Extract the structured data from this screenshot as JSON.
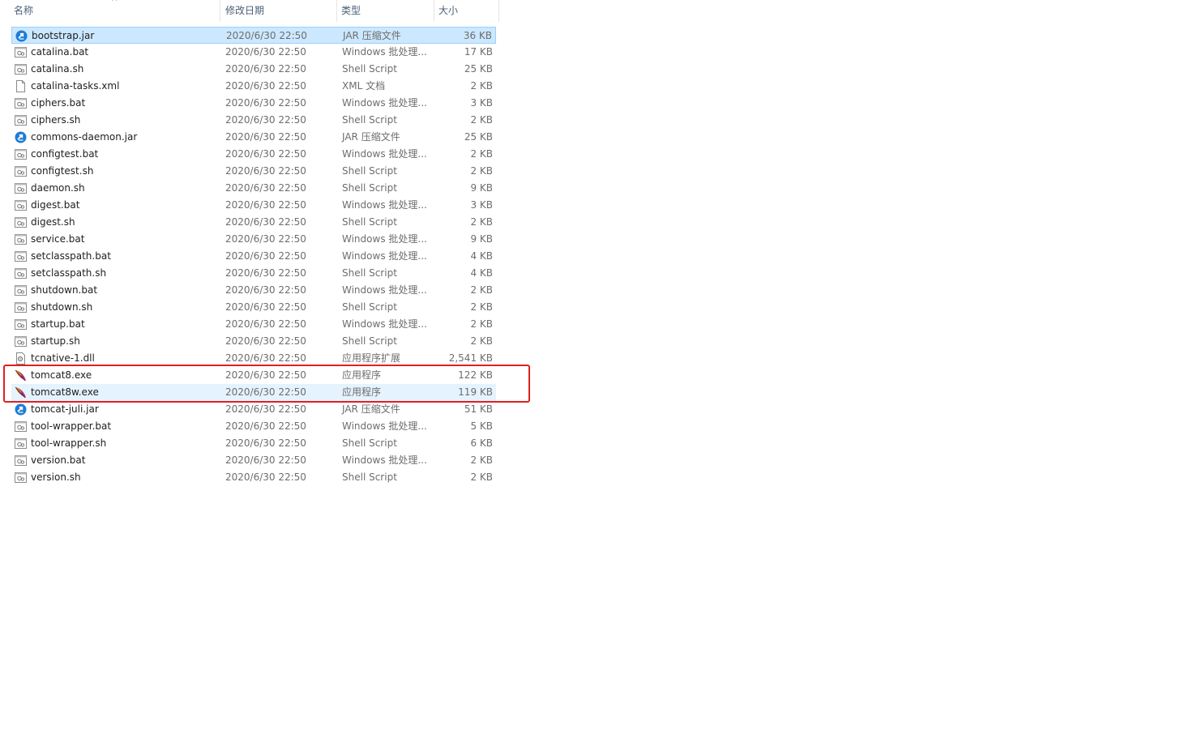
{
  "columns": {
    "name": "名称",
    "date": "修改日期",
    "type": "类型",
    "size": "大小"
  },
  "sort_indicator": "^",
  "files": [
    {
      "name": "bootstrap.jar",
      "date": "2020/6/30 22:50",
      "type": "JAR 压缩文件",
      "size": "36 KB",
      "icon": "jar-icon",
      "state": "selected"
    },
    {
      "name": "catalina.bat",
      "date": "2020/6/30 22:50",
      "type": "Windows 批处理...",
      "size": "17 KB",
      "icon": "script-icon"
    },
    {
      "name": "catalina.sh",
      "date": "2020/6/30 22:50",
      "type": "Shell Script",
      "size": "25 KB",
      "icon": "script-icon"
    },
    {
      "name": "catalina-tasks.xml",
      "date": "2020/6/30 22:50",
      "type": "XML 文档",
      "size": "2 KB",
      "icon": "document-icon"
    },
    {
      "name": "ciphers.bat",
      "date": "2020/6/30 22:50",
      "type": "Windows 批处理...",
      "size": "3 KB",
      "icon": "script-icon"
    },
    {
      "name": "ciphers.sh",
      "date": "2020/6/30 22:50",
      "type": "Shell Script",
      "size": "2 KB",
      "icon": "script-icon"
    },
    {
      "name": "commons-daemon.jar",
      "date": "2020/6/30 22:50",
      "type": "JAR 压缩文件",
      "size": "25 KB",
      "icon": "jar-icon"
    },
    {
      "name": "configtest.bat",
      "date": "2020/6/30 22:50",
      "type": "Windows 批处理...",
      "size": "2 KB",
      "icon": "script-icon"
    },
    {
      "name": "configtest.sh",
      "date": "2020/6/30 22:50",
      "type": "Shell Script",
      "size": "2 KB",
      "icon": "script-icon"
    },
    {
      "name": "daemon.sh",
      "date": "2020/6/30 22:50",
      "type": "Shell Script",
      "size": "9 KB",
      "icon": "script-icon"
    },
    {
      "name": "digest.bat",
      "date": "2020/6/30 22:50",
      "type": "Windows 批处理...",
      "size": "3 KB",
      "icon": "script-icon"
    },
    {
      "name": "digest.sh",
      "date": "2020/6/30 22:50",
      "type": "Shell Script",
      "size": "2 KB",
      "icon": "script-icon"
    },
    {
      "name": "service.bat",
      "date": "2020/6/30 22:50",
      "type": "Windows 批处理...",
      "size": "9 KB",
      "icon": "script-icon"
    },
    {
      "name": "setclasspath.bat",
      "date": "2020/6/30 22:50",
      "type": "Windows 批处理...",
      "size": "4 KB",
      "icon": "script-icon"
    },
    {
      "name": "setclasspath.sh",
      "date": "2020/6/30 22:50",
      "type": "Shell Script",
      "size": "4 KB",
      "icon": "script-icon"
    },
    {
      "name": "shutdown.bat",
      "date": "2020/6/30 22:50",
      "type": "Windows 批处理...",
      "size": "2 KB",
      "icon": "script-icon"
    },
    {
      "name": "shutdown.sh",
      "date": "2020/6/30 22:50",
      "type": "Shell Script",
      "size": "2 KB",
      "icon": "script-icon"
    },
    {
      "name": "startup.bat",
      "date": "2020/6/30 22:50",
      "type": "Windows 批处理...",
      "size": "2 KB",
      "icon": "script-icon"
    },
    {
      "name": "startup.sh",
      "date": "2020/6/30 22:50",
      "type": "Shell Script",
      "size": "2 KB",
      "icon": "script-icon"
    },
    {
      "name": "tcnative-1.dll",
      "date": "2020/6/30 22:50",
      "type": "应用程序扩展",
      "size": "2,541 KB",
      "icon": "dll-icon"
    },
    {
      "name": "tomcat8.exe",
      "date": "2020/6/30 22:50",
      "type": "应用程序",
      "size": "122 KB",
      "icon": "tomcat-feather-icon",
      "highlighted": true
    },
    {
      "name": "tomcat8w.exe",
      "date": "2020/6/30 22:50",
      "type": "应用程序",
      "size": "119 KB",
      "icon": "tomcat-feather-icon",
      "highlighted": true,
      "state": "hover"
    },
    {
      "name": "tomcat-juli.jar",
      "date": "2020/6/30 22:50",
      "type": "JAR 压缩文件",
      "size": "51 KB",
      "icon": "jar-icon"
    },
    {
      "name": "tool-wrapper.bat",
      "date": "2020/6/30 22:50",
      "type": "Windows 批处理...",
      "size": "5 KB",
      "icon": "script-icon"
    },
    {
      "name": "tool-wrapper.sh",
      "date": "2020/6/30 22:50",
      "type": "Shell Script",
      "size": "6 KB",
      "icon": "script-icon"
    },
    {
      "name": "version.bat",
      "date": "2020/6/30 22:50",
      "type": "Windows 批处理...",
      "size": "2 KB",
      "icon": "script-icon"
    },
    {
      "name": "version.sh",
      "date": "2020/6/30 22:50",
      "type": "Shell Script",
      "size": "2 KB",
      "icon": "script-icon"
    }
  ],
  "colors": {
    "selected_bg": "#cce8ff",
    "hover_bg": "#e5f3ff",
    "highlight_border": "#e0201f",
    "header_text": "#4c607a",
    "secondary_text": "#6d6d6d"
  }
}
